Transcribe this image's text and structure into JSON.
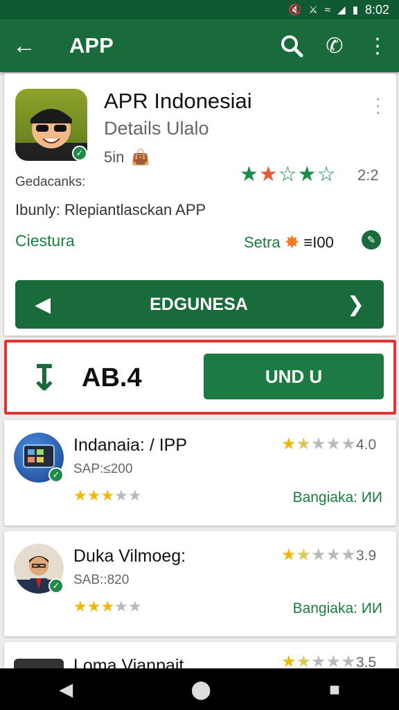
{
  "status": {
    "time": "8:02"
  },
  "appbar": {
    "title": "APP"
  },
  "main": {
    "title": "APR Indonesiai",
    "subtitle": "Details Ulalo",
    "size": "5in",
    "label_left": "Gedacanks:",
    "rating": "2:2",
    "description": "Ibunly: Rlepiantlasckan APP",
    "category": "Ciestura",
    "setra_label": "Setra",
    "setra_value": "≡I00",
    "nav_label": "EDGUNESA"
  },
  "download": {
    "value": "AB.4",
    "button_label": "UND U"
  },
  "list": [
    {
      "title": "Indanaia: / IPP",
      "subtitle": "SAP:≤200",
      "rating": "4.0",
      "tag": "Bangiaka: ИИ"
    },
    {
      "title": "Duka Vilmoeɡ:",
      "subtitle": "SAB::820",
      "rating": "3.9",
      "tag": "Bangiaka: ИИ"
    },
    {
      "title": "Loma Vianpait",
      "subtitle": "",
      "rating": "3.5",
      "tag": ""
    }
  ],
  "colors": {
    "brand": "#196b3c",
    "accent": "#1e7a44",
    "highlight": "#e03434"
  }
}
